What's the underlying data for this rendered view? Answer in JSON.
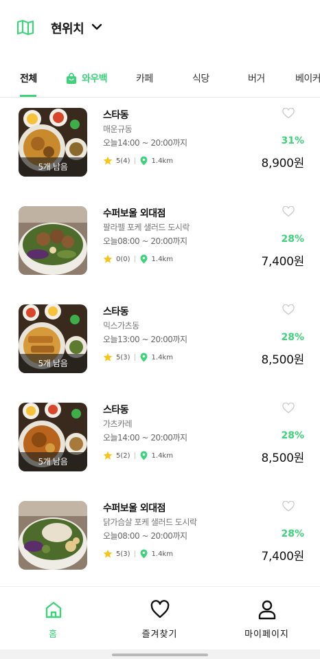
{
  "header": {
    "location_label": "현위치",
    "map_icon": "map-icon",
    "dropdown_icon": "chevron-down-icon"
  },
  "tabs": [
    {
      "label": "전체",
      "active": true
    },
    {
      "label": "와우백",
      "icon": "shopping-bag-icon"
    },
    {
      "label": "카페"
    },
    {
      "label": "식당"
    },
    {
      "label": "버거"
    },
    {
      "label": "베이커"
    }
  ],
  "items": [
    {
      "name": "스타동",
      "menu": "매운규동",
      "hours": "오늘14:00 ~ 20:00까지",
      "rating": "5(4)",
      "distance": "1.4km",
      "discount": "31%",
      "price": "8,900원",
      "badge": "5개 남음"
    },
    {
      "name": "수퍼보울 외대점",
      "menu": "팔라펠 포케 샐러드 도시락",
      "hours": "오늘08:00 ~ 20:00까지",
      "rating": "0(0)",
      "distance": "1.4km",
      "discount": "28%",
      "price": "7,400원",
      "badge": ""
    },
    {
      "name": "스타동",
      "menu": "믹스가츠동",
      "hours": "오늘13:00 ~ 20:00까지",
      "rating": "5(3)",
      "distance": "1.4km",
      "discount": "28%",
      "price": "8,500원",
      "badge": "5개 남음"
    },
    {
      "name": "스타동",
      "menu": "가츠카레",
      "hours": "오늘14:00 ~ 20:00까지",
      "rating": "5(2)",
      "distance": "1.4km",
      "discount": "28%",
      "price": "8,500원",
      "badge": "5개 남음"
    },
    {
      "name": "수퍼보울 외대점",
      "menu": "닭가슴살 포케 샐러드 도시락",
      "hours": "오늘08:00 ~ 20:00까지",
      "rating": "5(3)",
      "distance": "1.4km",
      "discount": "28%",
      "price": "7,400원",
      "badge": ""
    }
  ],
  "bottom_nav": [
    {
      "label": "홈",
      "icon": "home-icon",
      "active": true
    },
    {
      "label": "즐겨찾기",
      "icon": "heart-icon"
    },
    {
      "label": "마이페이지",
      "icon": "user-icon"
    }
  ],
  "colors": {
    "accent": "#3dd37a",
    "text": "#111111",
    "muted": "#777777",
    "star": "#f5c518"
  }
}
